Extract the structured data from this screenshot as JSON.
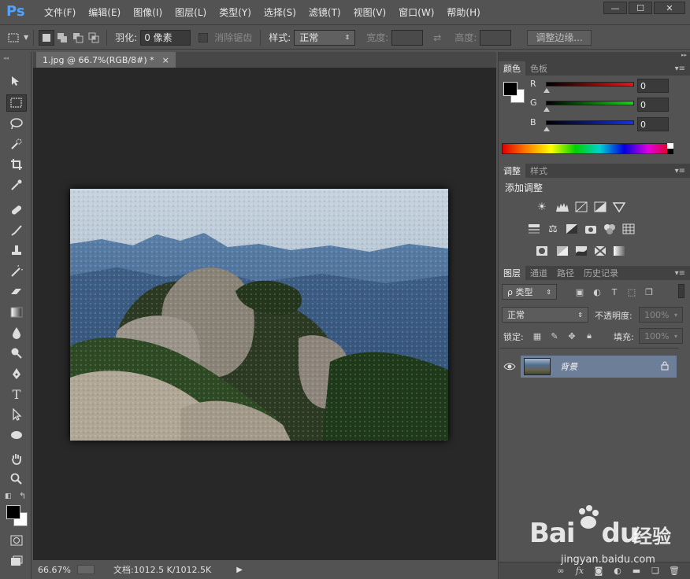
{
  "app": {
    "logo": "Ps"
  },
  "menu": [
    "文件(F)",
    "编辑(E)",
    "图像(I)",
    "图层(L)",
    "类型(Y)",
    "选择(S)",
    "滤镜(T)",
    "视图(V)",
    "窗口(W)",
    "帮助(H)"
  ],
  "window_controls": {
    "minimize": "—",
    "maximize": "☐",
    "close": "✕"
  },
  "options": {
    "feather_label": "羽化:",
    "feather_value": "0 像素",
    "antialias_label": "消除锯齿",
    "style_label": "样式:",
    "style_value": "正常",
    "width_label": "宽度:",
    "height_label": "高度:",
    "refine_edge": "调整边缘..."
  },
  "document": {
    "tab_title": "1.jpg @ 66.7%(RGB/8#) *",
    "tab_close": "×",
    "zoom": "66.67%",
    "doc_info": "文档:1012.5 K/1012.5K"
  },
  "color_panel": {
    "tabs": [
      "颜色",
      "色板"
    ],
    "channels": [
      {
        "label": "R",
        "value": "0",
        "color": "#d02020"
      },
      {
        "label": "G",
        "value": "0",
        "color": "#20c020"
      },
      {
        "label": "B",
        "value": "0",
        "color": "#2030d0"
      }
    ]
  },
  "adjustments_panel": {
    "tabs": [
      "调整",
      "样式"
    ],
    "title": "添加调整"
  },
  "layers_panel": {
    "tabs": [
      "图层",
      "通道",
      "路径",
      "历史记录"
    ],
    "filter_label": "ρ 类型",
    "blend_mode": "正常",
    "opacity_label": "不透明度:",
    "opacity_value": "100%",
    "lock_label": "锁定:",
    "fill_label": "填充:",
    "fill_value": "100%",
    "layers": [
      {
        "name": "背景",
        "visible": true,
        "locked": true
      }
    ]
  },
  "watermark": {
    "brand": "Bai",
    "brand2": "du",
    "cn": "经验",
    "url": "jingyan.baidu.com"
  }
}
